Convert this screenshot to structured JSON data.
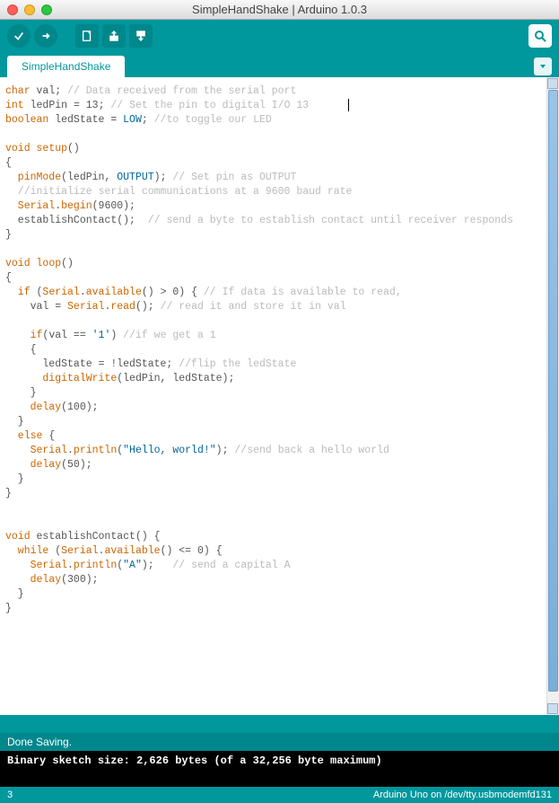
{
  "window": {
    "title": "SimpleHandShake | Arduino 1.0.3"
  },
  "tabs": {
    "active": "SimpleHandShake"
  },
  "status": {
    "msg": "Done Saving.",
    "console": "Binary sketch size: 2,626 bytes (of a 32,256 byte maximum)"
  },
  "footer": {
    "line": "3",
    "board": "Arduino Uno on /dev/tty.usbmodemfd131"
  },
  "code": {
    "l01": {
      "t1": "char",
      "id": " val",
      "p": ";",
      "c": " // Data received from the serial port"
    },
    "l02": {
      "t1": "int",
      "id": " ledPin ",
      "op": "=",
      "num": " 13",
      "p": ";",
      "c": " // Set the pin to digital I/O 13"
    },
    "l03": {
      "t1": "boolean",
      "id": " ledState ",
      "op": "=",
      "cst": " LOW",
      "p": ";",
      "c": " //to toggle our LED"
    },
    "l05": {
      "kw": "void",
      "fn": " setup",
      "paren": "()"
    },
    "l06": {
      "br": "{"
    },
    "l07": {
      "fn": "  pinMode",
      "args": "(ledPin, ",
      "cst": "OUTPUT",
      "end": ");",
      "c": " // Set pin as OUTPUT"
    },
    "l08": {
      "c": "  //initialize serial communications at a 9600 baud rate"
    },
    "l09": {
      "lib": "  Serial",
      "dot": ".",
      "fn": "begin",
      "args": "(9600);"
    },
    "l10": {
      "id": "  establishContact();",
      "c": "  // send a byte to establish contact until receiver responds"
    },
    "l11": {
      "br": "}"
    },
    "l13": {
      "kw": "void",
      "fn": " loop",
      "paren": "()"
    },
    "l14": {
      "br": "{"
    },
    "l15": {
      "kw": "  if",
      "args": " (",
      "lib": "Serial",
      "dot": ".",
      "fn": "available",
      "tail": "() > 0) {",
      "c": " // If data is available to read,"
    },
    "l16": {
      "id": "    val = ",
      "lib": "Serial",
      "dot": ".",
      "fn": "read",
      "tail": "();",
      "c": " // read it and store it in val"
    },
    "l18": {
      "kw": "    if",
      "args": "(val == ",
      "str": "'1'",
      "tail": ")",
      "c": " //if we get a 1"
    },
    "l19": {
      "br": "    {"
    },
    "l20": {
      "id": "      ledState = !ledState;",
      "c": " //flip the ledState"
    },
    "l21": {
      "fn": "      digitalWrite",
      "args": "(ledPin, ledState);"
    },
    "l22": {
      "br": "    }"
    },
    "l23": {
      "fn": "    delay",
      "args": "(100);"
    },
    "l24": {
      "br": "  }"
    },
    "l25": {
      "kw": "  else",
      "br": " {"
    },
    "l26": {
      "lib": "    Serial",
      "dot": ".",
      "fn": "println",
      "args": "(",
      "str": "\"Hello, world!\"",
      "tail": ");",
      "c": " //send back a hello world"
    },
    "l27": {
      "fn": "    delay",
      "args": "(50);"
    },
    "l28": {
      "br": "  }"
    },
    "l29": {
      "br": "}"
    },
    "l32": {
      "kw": "void",
      "id": " establishContact() {"
    },
    "l33": {
      "kw": "  while",
      "args": " (",
      "lib": "Serial",
      "dot": ".",
      "fn": "available",
      "tail": "() <= 0) {"
    },
    "l34": {
      "lib": "    Serial",
      "dot": ".",
      "fn": "println",
      "args": "(",
      "str": "\"A\"",
      "tail": ");",
      "c": "   // send a capital A"
    },
    "l35": {
      "fn": "    delay",
      "args": "(300);"
    },
    "l36": {
      "br": "  }"
    },
    "l37": {
      "br": "}"
    }
  }
}
